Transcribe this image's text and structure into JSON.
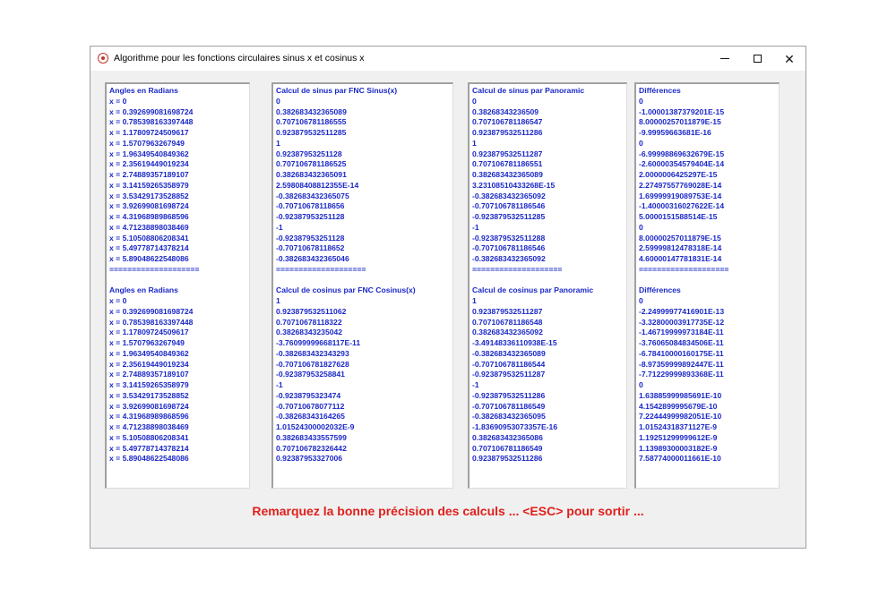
{
  "window": {
    "title": "Algorithme pour les fonctions circulaires sinus x et cosinus x",
    "controls": {
      "minimize": "minimize-icon",
      "maximize": "maximize-icon",
      "close": "close-icon"
    }
  },
  "columns": {
    "angles": [
      "Angles en Radians",
      "x = 0",
      "x = 0.392699081698724",
      "x = 0.785398163397448",
      "x = 1.17809724509617",
      "x = 1.5707963267949",
      "x = 1.96349540849362",
      "x = 2.35619449019234",
      "x = 2.74889357189107",
      "x = 3.14159265358979",
      "x = 3.53429173528852",
      "x = 3.92699081698724",
      "x = 4.31968989868596",
      "x = 4.71238898038469",
      "x = 5.10508806208341",
      "x = 5.49778714378214",
      "x = 5.89048622548086",
      "====================",
      "",
      "Angles en Radians",
      "x = 0",
      "x = 0.392699081698724",
      "x = 0.785398163397448",
      "x = 1.17809724509617",
      "x = 1.5707963267949",
      "x = 1.96349540849362",
      "x = 2.35619449019234",
      "x = 2.74889357189107",
      "x = 3.14159265358979",
      "x = 3.53429173528852",
      "x = 3.92699081698724",
      "x = 4.31968989868596",
      "x = 4.71238898038469",
      "x = 5.10508806208341",
      "x = 5.49778714378214",
      "x = 5.89048622548086"
    ],
    "fnc": [
      "Calcul de sinus par FNC Sinus(x)",
      "0",
      "0.382683432365089",
      "0.707106781186555",
      "0.923879532511285",
      "1",
      "0.92387953251128",
      "0.707106781186525",
      "0.382683432365091",
      "2.59808408812355E-14",
      "-0.382683432365075",
      "-0.70710678118656",
      "-0.92387953251128",
      "-1",
      "-0.92387953251128",
      "-0.70710678118652",
      "-0.382683432365046",
      "====================",
      "",
      "Calcul de cosinus par FNC Cosinus(x)",
      "1",
      "0.923879532511062",
      "0.70710678118322",
      "0.38268343235042",
      "-3.76099999668117E-11",
      "-0.382683432343293",
      "-0.707106781827628",
      "-0.92387953258841",
      "-1",
      "-0.9238795323474",
      "-0.70710678077112",
      "-0.38268343164265",
      "1.01524300002032E-9",
      "0.382683433557599",
      "0.707106782326442",
      "0.92387953327006"
    ],
    "panoramic": [
      "Calcul de sinus par Panoramic",
      "0",
      "0.38268343236509",
      "0.70710678118654​7",
      "0.923879532511286",
      "1",
      "0.923879532511287",
      "0.707106781186551",
      "0.382683432365089",
      "3.23108510433268E-15",
      "-0.382683432365092",
      "-0.707106781186546",
      "-0.923879532511285",
      "-1",
      "-0.923879532511288",
      "-0.707106781186546",
      "-0.382683432365092",
      "====================",
      "",
      "Calcul de cosinus par Panoramic",
      "1",
      "0.923879532511287",
      "0.707106781186548",
      "0.382683432365092",
      "-3.49148336110938E-15",
      "-0.382683432365089",
      "-0.707106781186544",
      "-0.923879532511287",
      "-1",
      "-0.923879532511286",
      "-0.707106781186549",
      "-0.382683432365095",
      "-1.83690953073357E-16",
      "0.382683432365086",
      "0.707106781186549",
      "0.923879532511286"
    ],
    "differences": [
      "Différences",
      "0",
      "-1.00001387379201E-15",
      "8.00000257011879E-15",
      "-9.99959663681E-16",
      "0",
      "-6.99998869632679E-15",
      "-2.60000354579404E-14",
      "2.0000006425297E-15",
      "2.27497557769028E-14",
      "1.69999919089753E-14",
      "-1.40000316027622E-14",
      "5.0000151588514E-15",
      "0",
      "8.00000257011879E-15",
      "2.59999812478318E-14",
      "4.60000147781831E-14",
      "====================",
      "",
      "Différences",
      "0",
      "-2.24999977416901E-13",
      "-3.32800003917735E-12",
      "-1.46719999973184E-11",
      "-3.76065084834506E-11",
      "-6.78410000160175E-11",
      "-8.97359999892447E-11",
      "-7.71229999893368E-11",
      "0",
      "1.63885999985691E-10",
      "4.1542899995679E-10",
      "7.22444999982051E-10",
      "1.01524318371127E-9",
      "1.19251299999612E-9",
      "1.13989300003182E-9",
      "7.58774000011661E-10"
    ]
  },
  "remark": "Remarquez la bonne précision des calculs ... <ESC> pour sortir ...",
  "colors": {
    "values": "#1a28c8",
    "remark": "#e0201c",
    "background": "#f0f0f0"
  }
}
